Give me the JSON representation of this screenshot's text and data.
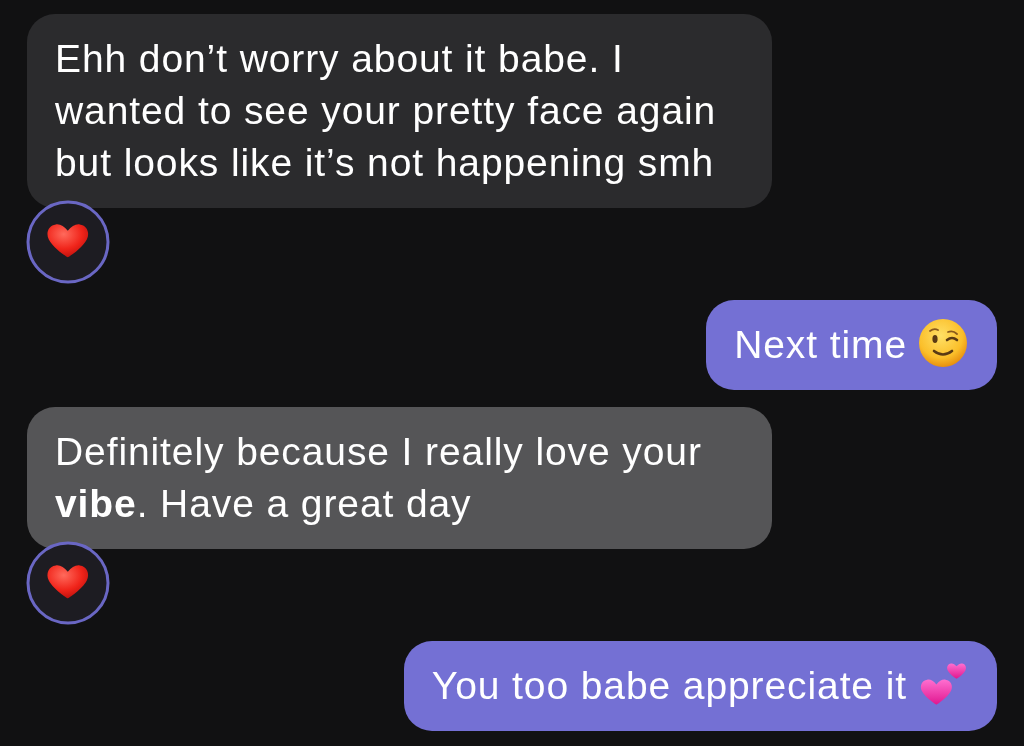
{
  "messages": [
    {
      "outgoing": false,
      "highlighted": false,
      "kind": "plain",
      "text": "Ehh don’t worry about it babe. I wanted to see your pretty face again but looks like it’s not happening smh",
      "reacted": true
    },
    {
      "outgoing": true,
      "highlighted": false,
      "kind": "winking",
      "text": "Next time",
      "reacted": false
    },
    {
      "outgoing": false,
      "highlighted": true,
      "kind": "plain",
      "text": "Definitely because I really love your **vibe**. Have a great day",
      "reacted": true
    },
    {
      "outgoing": true,
      "highlighted": false,
      "kind": "hearts",
      "text": "You too babe appreciate it",
      "reacted": false
    }
  ]
}
